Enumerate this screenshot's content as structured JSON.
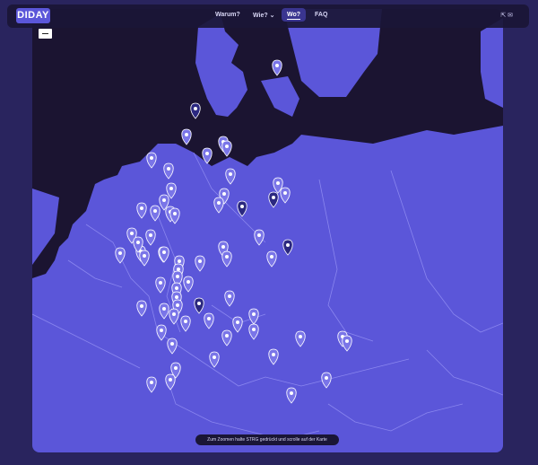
{
  "header": {
    "logo_text": "DIDAY",
    "nav": [
      {
        "label": "Warum?",
        "active": false
      },
      {
        "label": "Wie?",
        "active": false,
        "has_dropdown": true
      },
      {
        "label": "Wo?",
        "active": true
      },
      {
        "label": "FAQ",
        "active": false
      }
    ],
    "tools_text": "⇱  ✉"
  },
  "map": {
    "hint": "Zum Zoomen halte STRG gedrückt und scrolle auf der Karte",
    "land_color": "#5b56d9",
    "sea_color": "#1b1431",
    "pin_color": "#7a75e8",
    "pin_dark_color": "#2b2880"
  }
}
